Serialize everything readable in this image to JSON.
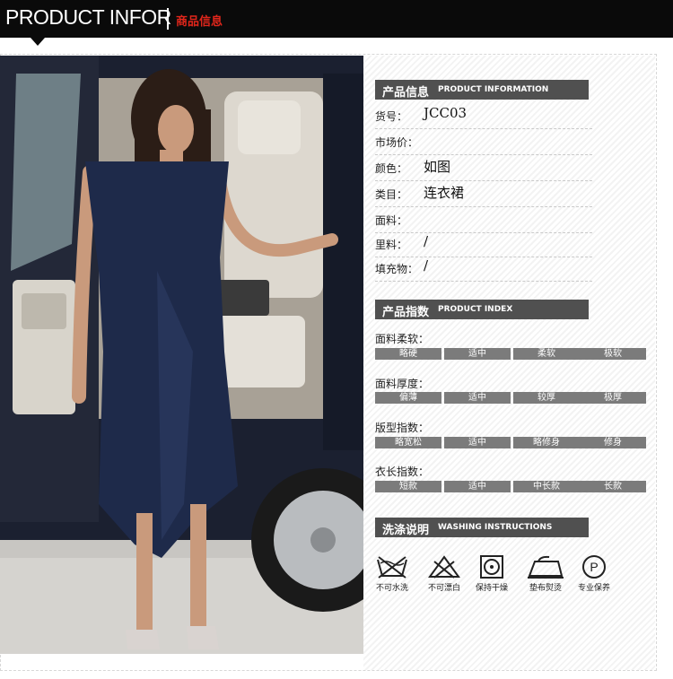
{
  "header": {
    "title": "PRODUCT INFOR",
    "subtitle": "商品信息"
  },
  "info": {
    "heading_cn": "产品信息",
    "heading_en": "PRODUCT INFORMATION",
    "rows": [
      {
        "key": "货号：",
        "value": "JCC03"
      },
      {
        "key": "市场价：",
        "value": ""
      },
      {
        "key": "颜色：",
        "value": "如图"
      },
      {
        "key": "类目：",
        "value": "连衣裙"
      },
      {
        "key": "面料：",
        "value": ""
      },
      {
        "key": "里料：",
        "value": "/"
      },
      {
        "key": "填充物：",
        "value": "/"
      }
    ]
  },
  "index": {
    "heading_cn": "产品指数",
    "heading_en": "PRODUCT INDEX",
    "groups": [
      {
        "label": "面料柔软：",
        "options": [
          "略硬",
          "适中",
          "柔软",
          "极软"
        ]
      },
      {
        "label": "面料厚度：",
        "options": [
          "偏薄",
          "适中",
          "较厚",
          "极厚"
        ]
      },
      {
        "label": "版型指数：",
        "options": [
          "略宽松",
          "适中",
          "略修身",
          "修身"
        ]
      },
      {
        "label": "衣长指数：",
        "options": [
          "短款",
          "适中",
          "中长款",
          "长款"
        ]
      }
    ]
  },
  "washing": {
    "heading_cn": "洗涤说明",
    "heading_en": "WASHING INSTRUCTIONS",
    "items": [
      {
        "icon": "no-hand-wash-icon",
        "label": "不可水洗"
      },
      {
        "icon": "no-bleach-icon",
        "label": "不可漂白"
      },
      {
        "icon": "tumble-dry-icon",
        "label": "保持干燥"
      },
      {
        "icon": "iron-icon",
        "label": "垫布熨烫"
      },
      {
        "icon": "professional-clean-icon",
        "label": "专业保养"
      }
    ]
  },
  "colors": {
    "header_bg": "#0a0a0a",
    "accent": "#e0261b",
    "section_bg": "#505050",
    "bar_bg": "#7b7b7b",
    "dress": "#1e2a4a"
  }
}
